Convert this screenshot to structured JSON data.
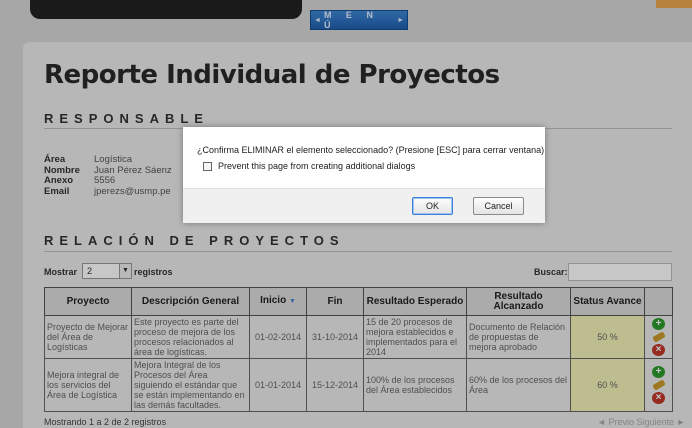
{
  "nav": {
    "menu_label": "M E N Ú",
    "menu_left_arrow": "◄",
    "menu_right_arrow": "►"
  },
  "page": {
    "title": "Reporte Individual de Proyectos"
  },
  "responsable": {
    "heading": "RESPONSABLE",
    "fields": [
      {
        "key": "Área",
        "value": "Logística"
      },
      {
        "key": "Nombre",
        "value": "Juan Pérez Sáenz"
      },
      {
        "key": "Anexo",
        "value": "5556"
      },
      {
        "key": "Email",
        "value": "jperezs@usmp.pe"
      }
    ]
  },
  "projects": {
    "heading": "RELACIÓN DE PROYECTOS",
    "show_label": "Mostrar",
    "show_value": "2",
    "records_label": "registros",
    "search_label": "Buscar:",
    "search_value": "",
    "columns": [
      "Proyecto",
      "Descripción General",
      "Inicio",
      "Fin",
      "Resultado Esperado",
      "Resultado Alcanzado",
      "Status Avance"
    ],
    "rows": [
      {
        "proyecto": "Proyecto de Mejorar del Área de Logísticas",
        "descripcion": "Este proyecto es parte del proceso de mejora de los procesos relacionados al área de logísticas.",
        "inicio": "01-02-2014",
        "fin": "31-10-2014",
        "esperado": "15 de 20 procesos de mejora establecidos e implementados para el 2014",
        "alcanzado": "Documento de Relación de propuestas de mejora aprobado",
        "status": "50 %"
      },
      {
        "proyecto": "Mejora integral de los servicios del Área de Logística",
        "descripcion": "Mejora Integral de los Procesos del Área siguiendo el estándar que se están implementando en las demás facultades.",
        "inicio": "01-01-2014",
        "fin": "15-12-2014",
        "esperado": "100% de los procesos del Área establecidos",
        "alcanzado": "60% de los procesos del Área",
        "status": "60 %"
      }
    ],
    "footer": "Mostrando 1 a 2 de 2 registros",
    "prev_label": "Previo",
    "next_label": "Siguiente"
  },
  "dialog": {
    "message": "¿Confirma ELIMINAR el elemento seleccionado? (Presione [ESC] para cerrar ventana)",
    "checkbox_label": "Prevent this page from creating additional dialogs",
    "ok_label": "OK",
    "cancel_label": "Cancel"
  }
}
